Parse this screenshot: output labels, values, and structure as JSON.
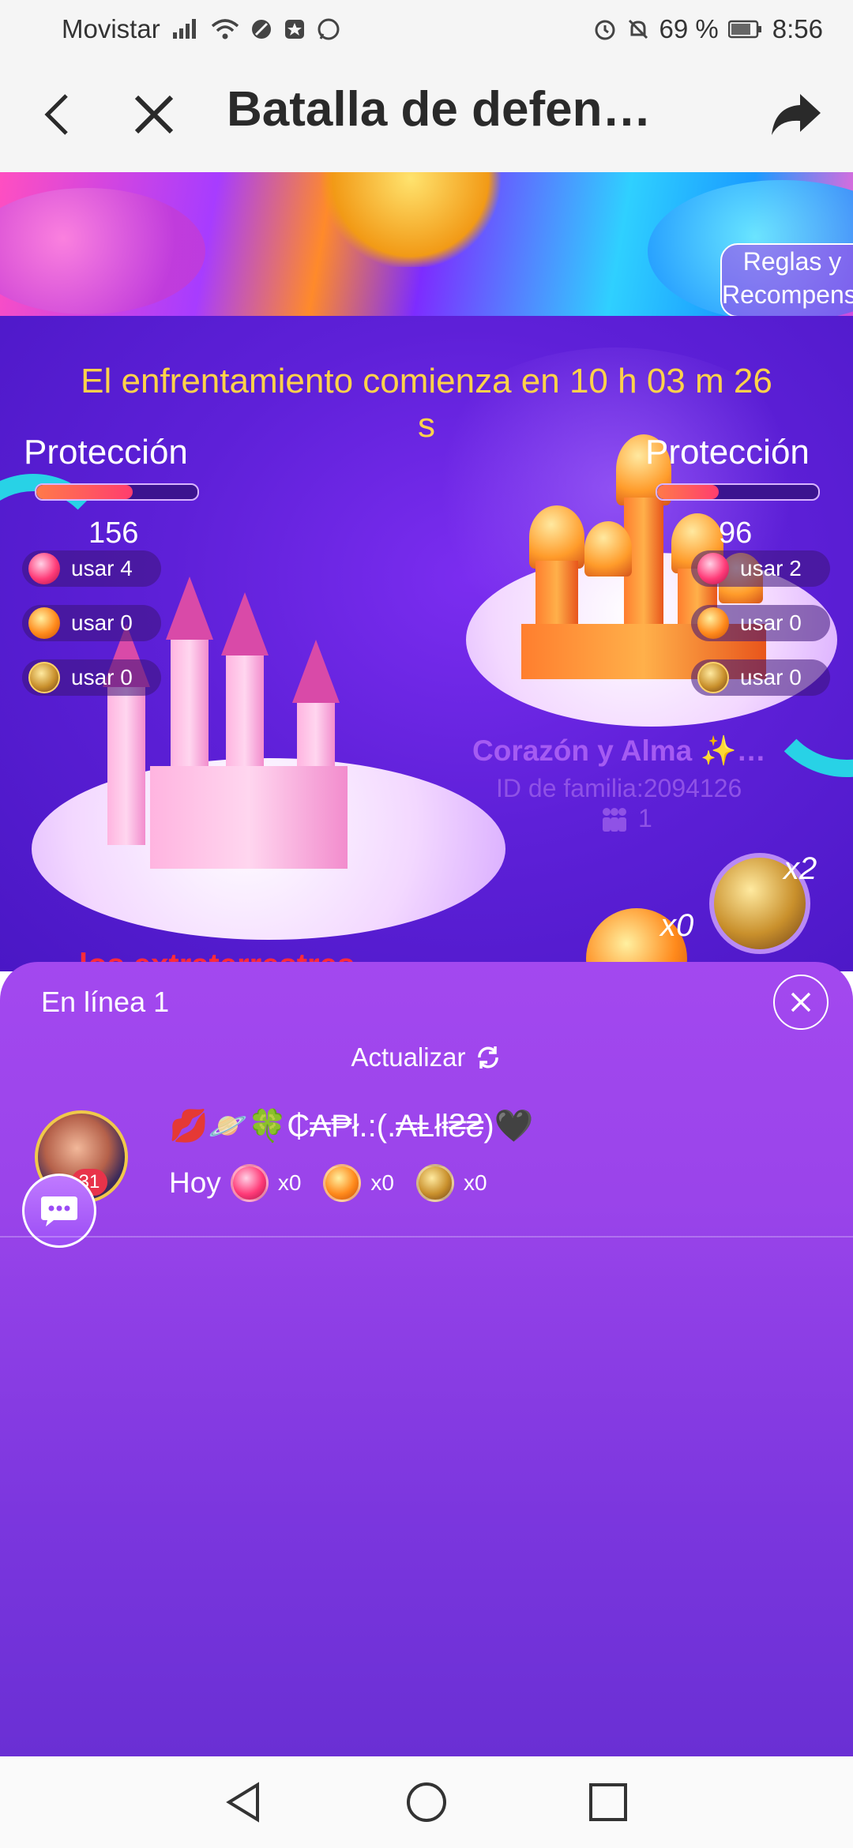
{
  "status_bar": {
    "carrier": "Movistar",
    "battery": "69 %",
    "time": "8:56"
  },
  "header": {
    "title": "Batalla de defen…"
  },
  "banner": {
    "rules_line1": "Reglas y",
    "rules_line2": "Recompensa"
  },
  "battle": {
    "countdown_line1": "El enfrentamiento comienza en 10 h 03 m 26",
    "countdown_line2": "s",
    "left": {
      "protection_label": "Protección",
      "protection_fill": 0.6,
      "score": "156",
      "items": [
        {
          "icon": "red-crystal-icon",
          "label": "usar",
          "count": "4"
        },
        {
          "icon": "fire-gem-icon",
          "label": "usar",
          "count": "0"
        },
        {
          "icon": "golden-ball-icon",
          "label": "usar",
          "count": "0"
        }
      ],
      "team_name": "los extraterrestres"
    },
    "right": {
      "protection_label": "Protección",
      "protection_fill": 0.38,
      "score": "96",
      "items": [
        {
          "icon": "red-crystal-icon",
          "label": "usar",
          "count": "2"
        },
        {
          "icon": "fire-gem-icon",
          "label": "usar",
          "count": "0"
        },
        {
          "icon": "golden-ball-icon",
          "label": "usar",
          "count": "0"
        }
      ],
      "family_name": "Corazón y Alma ✨…",
      "family_id": "ID de familia:2094126",
      "members": "1"
    },
    "bottom_items": [
      {
        "icon": "golden-ball-icon",
        "count": "x2"
      },
      {
        "icon": "fire-gem-icon",
        "count": "x0"
      }
    ]
  },
  "online_sheet": {
    "title": "En línea 1",
    "refresh_label": "Actualizar",
    "users": [
      {
        "name": "💋🪐🍀₵₳₱ł.:(.₳Ⱡłⱡ₴₴)🖤",
        "badge": "31",
        "today_label": "Hoy",
        "counts": [
          "x0",
          "x0",
          "x0"
        ]
      }
    ]
  },
  "colors": {
    "accent_yellow": "#ffd24a",
    "sheet_purple": "#9a44ea",
    "scene_purple": "#5e20d8"
  }
}
